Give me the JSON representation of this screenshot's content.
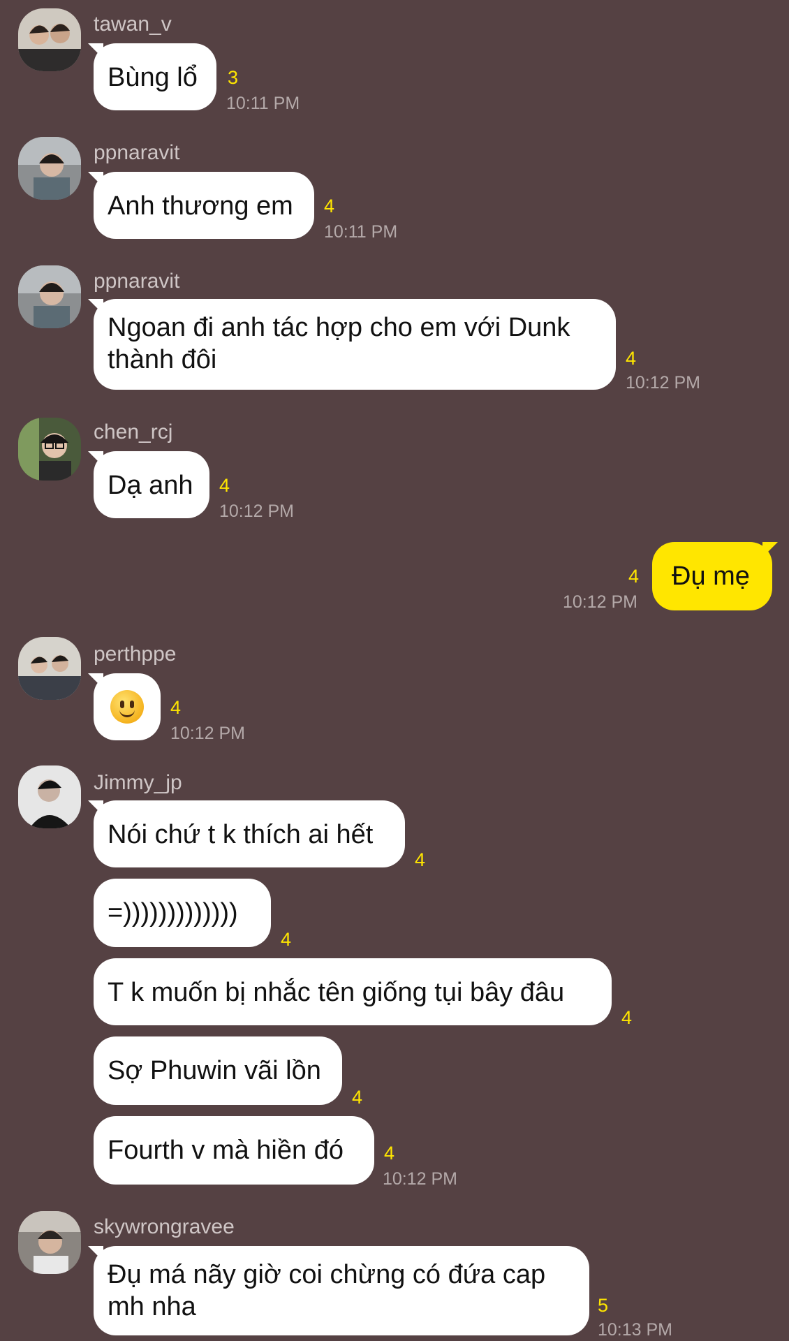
{
  "messages": [
    {
      "sender": "tawan_v",
      "lines": [
        "Bùng lổ"
      ],
      "unread": "3",
      "time": "10:11 PM"
    },
    {
      "sender": "ppnaravit",
      "lines": [
        "Anh thương em"
      ],
      "unread": "4",
      "time": "10:11 PM"
    },
    {
      "sender": "ppnaravit",
      "lines": [
        "Ngoan đi anh tác hợp cho em với Dunk",
        "thành đôi"
      ],
      "unread": "4",
      "time": "10:12 PM"
    },
    {
      "sender": "chen_rcj",
      "lines": [
        "Dạ anh"
      ],
      "unread": "4",
      "time": "10:12 PM"
    },
    {
      "sender": "",
      "lines": [
        "Đụ mẹ"
      ],
      "unread": "4",
      "time": "10:12 PM"
    },
    {
      "sender": "perthppe",
      "emoji": "slightly-smiling-face",
      "unread": "4",
      "time": "10:12 PM"
    },
    {
      "sender": "Jimmy_jp",
      "lines": [
        "Nói chứ t k thích ai hết"
      ],
      "unread": "4"
    },
    {
      "sender": "Jimmy_jp",
      "lines": [
        "=)))))))))))))"
      ],
      "unread": "4"
    },
    {
      "sender": "Jimmy_jp",
      "lines": [
        "T k muốn bị nhắc tên giống tụi bây đâu"
      ],
      "unread": "4"
    },
    {
      "sender": "Jimmy_jp",
      "lines": [
        "Sợ Phuwin vãi lồn"
      ],
      "unread": "4"
    },
    {
      "sender": "Jimmy_jp",
      "lines": [
        "Fourth v mà hiền đó"
      ],
      "unread": "4",
      "time": "10:12 PM"
    },
    {
      "sender": "skywrongravee",
      "lines": [
        "Đụ má nãy giờ coi chừng có đứa cap",
        "mh nha"
      ],
      "unread": "5",
      "time": "10:13 PM"
    }
  ],
  "colors": {
    "background": "#554143",
    "bubble": "#ffffff",
    "my_bubble": "#ffe600",
    "unread": "#ffe600"
  }
}
